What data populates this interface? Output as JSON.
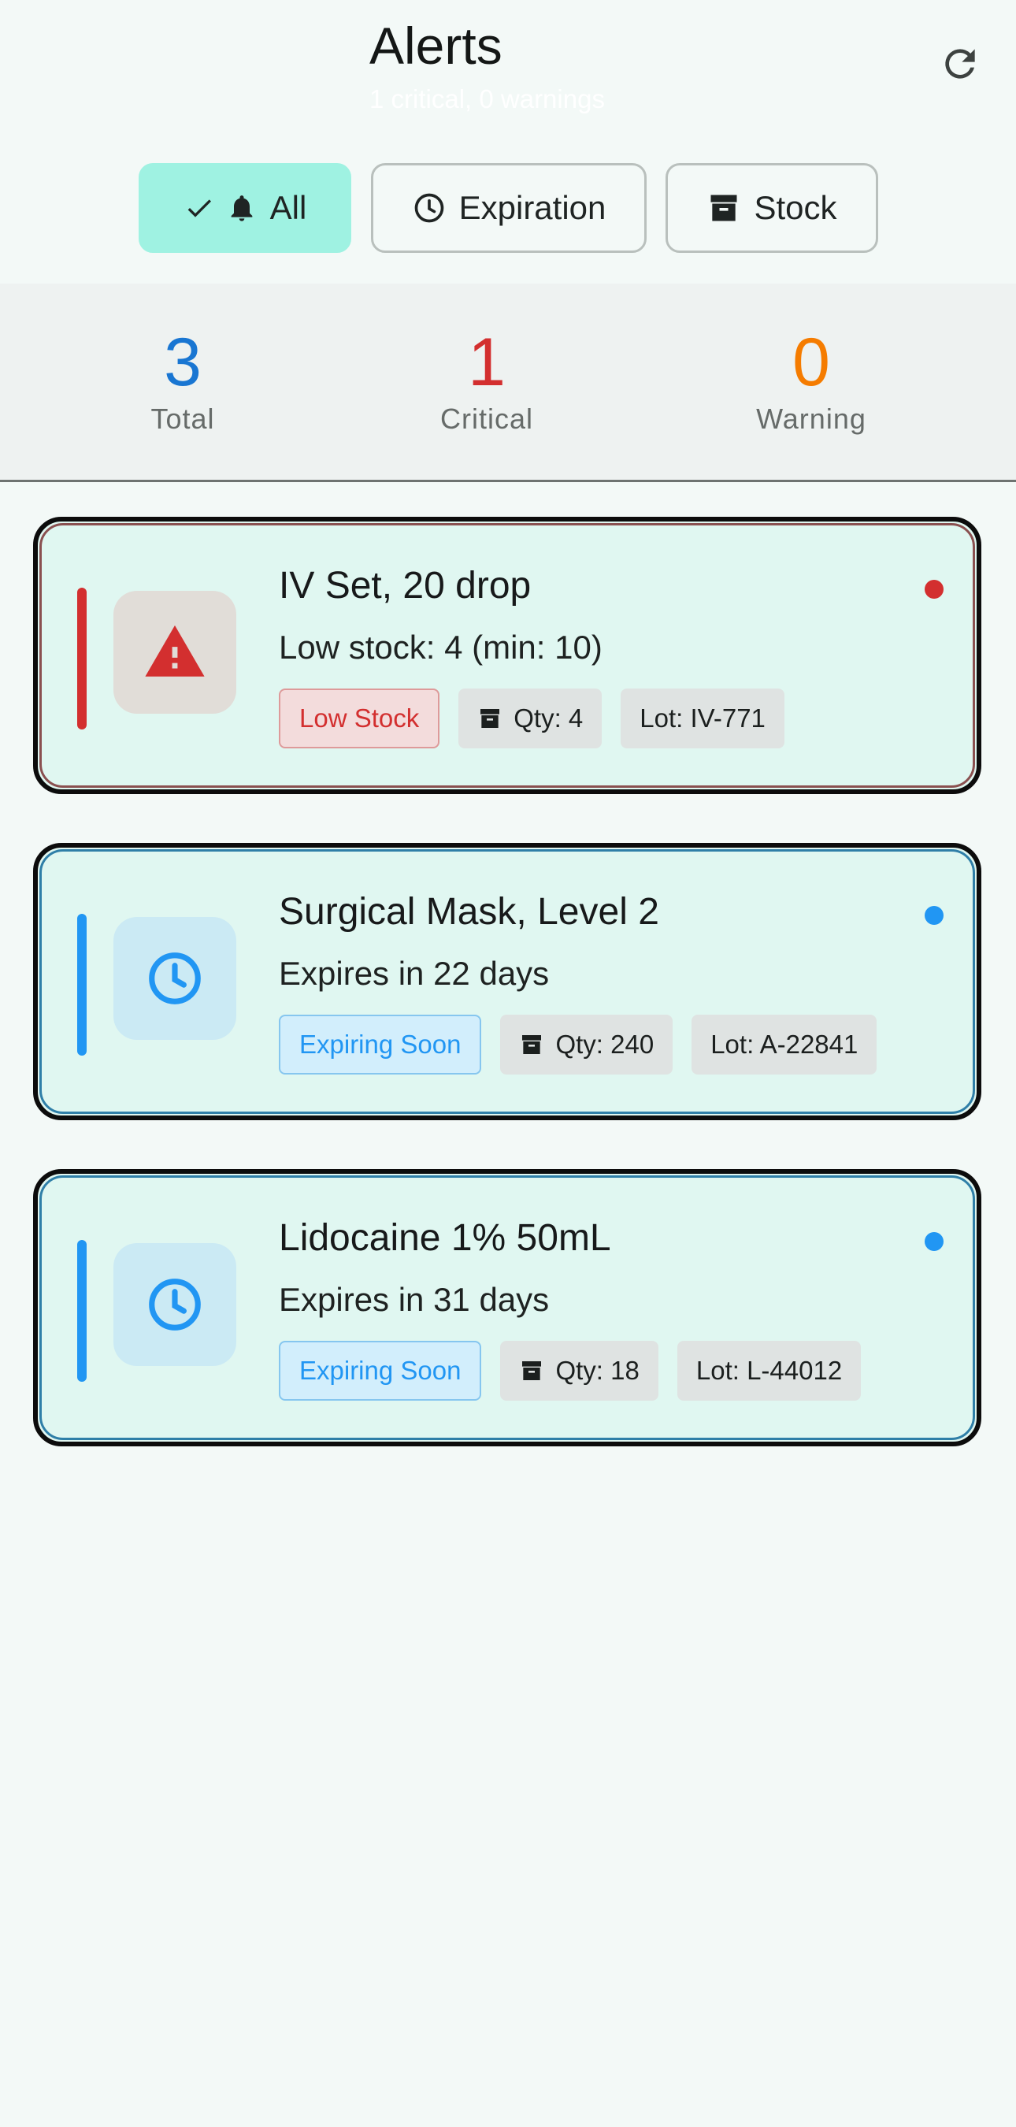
{
  "header": {
    "title": "Alerts",
    "subtitle": "1 critical, 0 warnings",
    "refresh_icon": "refresh-icon"
  },
  "filters": [
    {
      "label": "All",
      "selected": true,
      "icons": [
        "check-icon",
        "bell-icon"
      ]
    },
    {
      "label": "Expiration",
      "selected": false,
      "icons": [
        "clock-icon"
      ]
    },
    {
      "label": "Stock",
      "selected": false,
      "icons": [
        "archive-box-icon"
      ]
    }
  ],
  "summary": {
    "total": {
      "value": "3",
      "label": "Total",
      "color": "#1976d2"
    },
    "critical": {
      "value": "1",
      "label": "Critical",
      "color": "#d32f2f"
    },
    "warning": {
      "value": "0",
      "label": "Warning",
      "color": "#f57c00"
    }
  },
  "alerts": [
    {
      "severity": "critical",
      "icon": "warning-triangle-icon",
      "title": "IV Set, 20 drop",
      "description": "Low stock: 4 (min: 10)",
      "type_badge": "Low Stock",
      "qty": "Qty: 4",
      "lot": "Lot: IV-771",
      "accent": "#d32f2f"
    },
    {
      "severity": "info",
      "icon": "clock-icon",
      "title": "Surgical Mask, Level 2",
      "description": "Expires in 22 days",
      "type_badge": "Expiring Soon",
      "qty": "Qty: 240",
      "lot": "Lot: A-22841",
      "accent": "#2196f3"
    },
    {
      "severity": "info",
      "icon": "clock-icon",
      "title": "Lidocaine 1% 50mL",
      "description": "Expires in 31 days",
      "type_badge": "Expiring Soon",
      "qty": "Qty: 18",
      "lot": "Lot: L-44012",
      "accent": "#2196f3"
    }
  ]
}
